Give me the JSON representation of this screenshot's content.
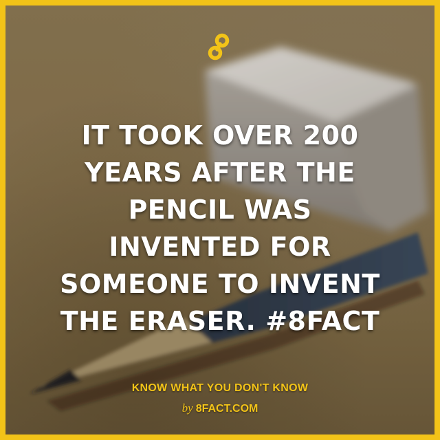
{
  "fact": {
    "lines": [
      "IT TOOK OVER 200",
      "YEARS AFTER THE",
      "PENCIL WAS",
      "INVENTED FOR",
      "SOMEONE TO INVENT",
      "THE ERASER. #8FACT"
    ]
  },
  "footer": {
    "tagline": "KNOW WHAT YOU DON'T KNOW",
    "by": "by",
    "site": "8FACT.COM"
  },
  "colors": {
    "accent": "#f2c318",
    "text": "#ffffff"
  },
  "icons": {
    "logo": "infinity-8-logo"
  }
}
